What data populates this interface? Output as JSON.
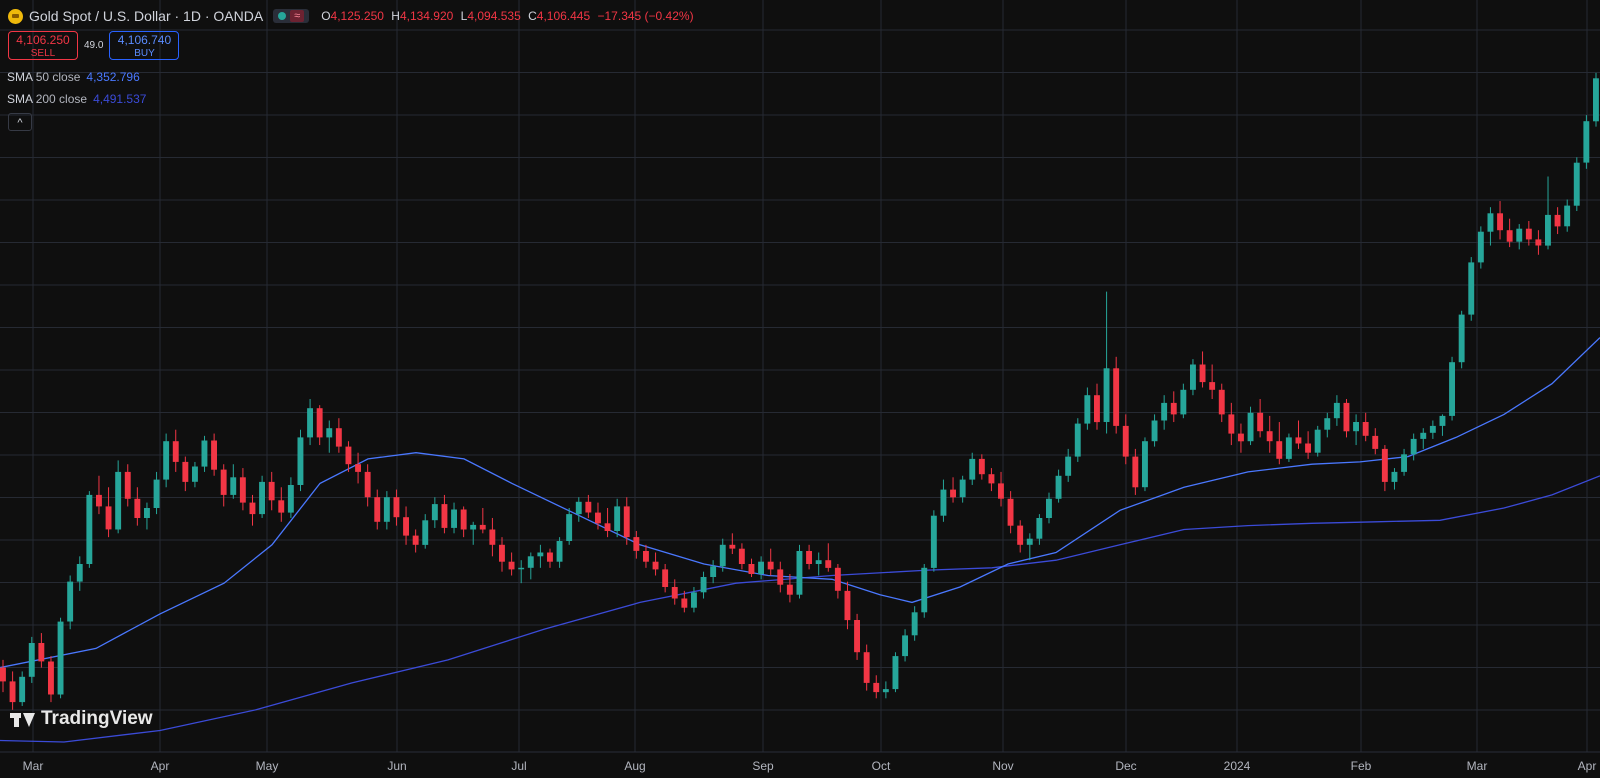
{
  "header": {
    "symbol_icon": "gold-coin-icon",
    "title": "Gold Spot / U.S. Dollar · 1D · OANDA",
    "ohlc": {
      "o": "4,125.250",
      "h": "4,134.920",
      "l": "4,094.535",
      "c": "4,106.445",
      "change": "−17.345 (−0.42%)"
    },
    "labels": {
      "o": "O",
      "h": "H",
      "l": "L",
      "c": "C"
    }
  },
  "trade": {
    "sell_price": "4,106.250",
    "sell_label": "SELL",
    "spread": "49.0",
    "buy_price": "4,106.740",
    "buy_label": "BUY"
  },
  "indicators": [
    {
      "name": "SMA",
      "params": "50 close",
      "value": "4,352.796",
      "color": "#4a78ff"
    },
    {
      "name": "SMA",
      "params": "200 close",
      "value": "4,491.537",
      "color": "#3b4bd8"
    }
  ],
  "collapse_glyph": "^",
  "branding": {
    "logo_text": "TradingView"
  },
  "colors": {
    "up": "#26a69a",
    "down": "#f23645",
    "background": "#0f0f0f",
    "grid": "#2a2e39"
  },
  "chart_data": {
    "type": "candlestick",
    "x_tick_labels": [
      "Mar",
      "Apr",
      "May",
      "Jun",
      "Jul",
      "Aug",
      "Sep",
      "Oct",
      "Nov",
      "Dec",
      "2024",
      "Feb",
      "Mar",
      "Apr"
    ],
    "y_range": [
      3880,
      4860
    ],
    "ohlc": [
      [
        3990,
        4000,
        3958,
        3972
      ],
      [
        3972,
        3985,
        3935,
        3945
      ],
      [
        3945,
        3985,
        3940,
        3978
      ],
      [
        3978,
        4030,
        3970,
        4022
      ],
      [
        4022,
        4035,
        3990,
        3998
      ],
      [
        3998,
        4005,
        3945,
        3955
      ],
      [
        3955,
        4055,
        3950,
        4050
      ],
      [
        4050,
        4110,
        4040,
        4102
      ],
      [
        4102,
        4135,
        4090,
        4125
      ],
      [
        4125,
        4220,
        4120,
        4215
      ],
      [
        4215,
        4240,
        4190,
        4200
      ],
      [
        4200,
        4225,
        4160,
        4170
      ],
      [
        4170,
        4260,
        4165,
        4245
      ],
      [
        4245,
        4255,
        4200,
        4210
      ],
      [
        4210,
        4225,
        4175,
        4185
      ],
      [
        4185,
        4205,
        4170,
        4198
      ],
      [
        4198,
        4245,
        4190,
        4235
      ],
      [
        4235,
        4295,
        4225,
        4285
      ],
      [
        4285,
        4300,
        4245,
        4258
      ],
      [
        4258,
        4265,
        4220,
        4232
      ],
      [
        4232,
        4258,
        4225,
        4252
      ],
      [
        4252,
        4292,
        4245,
        4286
      ],
      [
        4286,
        4295,
        4240,
        4248
      ],
      [
        4248,
        4255,
        4200,
        4215
      ],
      [
        4215,
        4255,
        4210,
        4238
      ],
      [
        4238,
        4250,
        4195,
        4205
      ],
      [
        4205,
        4215,
        4175,
        4190
      ],
      [
        4190,
        4240,
        4185,
        4232
      ],
      [
        4232,
        4245,
        4195,
        4208
      ],
      [
        4208,
        4225,
        4180,
        4192
      ],
      [
        4192,
        4238,
        4185,
        4228
      ],
      [
        4228,
        4300,
        4220,
        4290
      ],
      [
        4290,
        4340,
        4280,
        4328
      ],
      [
        4328,
        4332,
        4280,
        4290
      ],
      [
        4290,
        4312,
        4270,
        4302
      ],
      [
        4302,
        4315,
        4270,
        4278
      ],
      [
        4278,
        4285,
        4245,
        4255
      ],
      [
        4255,
        4270,
        4230,
        4245
      ],
      [
        4245,
        4255,
        4200,
        4212
      ],
      [
        4212,
        4222,
        4170,
        4180
      ],
      [
        4180,
        4220,
        4170,
        4212
      ],
      [
        4212,
        4222,
        4175,
        4186
      ],
      [
        4186,
        4200,
        4150,
        4162
      ],
      [
        4162,
        4170,
        4140,
        4150
      ],
      [
        4150,
        4190,
        4145,
        4182
      ],
      [
        4182,
        4212,
        4172,
        4203
      ],
      [
        4203,
        4215,
        4165,
        4172
      ],
      [
        4172,
        4205,
        4165,
        4196
      ],
      [
        4196,
        4200,
        4160,
        4170
      ],
      [
        4170,
        4180,
        4150,
        4176
      ],
      [
        4176,
        4198,
        4165,
        4170
      ],
      [
        4170,
        4185,
        4135,
        4150
      ],
      [
        4150,
        4160,
        4115,
        4128
      ],
      [
        4128,
        4140,
        4110,
        4118
      ],
      [
        4118,
        4130,
        4100,
        4120
      ],
      [
        4120,
        4140,
        4105,
        4135
      ],
      [
        4135,
        4150,
        4120,
        4140
      ],
      [
        4140,
        4145,
        4120,
        4128
      ],
      [
        4128,
        4160,
        4120,
        4155
      ],
      [
        4155,
        4198,
        4150,
        4190
      ],
      [
        4190,
        4212,
        4180,
        4206
      ],
      [
        4206,
        4215,
        4185,
        4192
      ],
      [
        4192,
        4205,
        4170,
        4178
      ],
      [
        4178,
        4198,
        4160,
        4168
      ],
      [
        4168,
        4210,
        4160,
        4200
      ],
      [
        4200,
        4212,
        4150,
        4160
      ],
      [
        4160,
        4168,
        4132,
        4142
      ],
      [
        4142,
        4150,
        4120,
        4128
      ],
      [
        4128,
        4140,
        4110,
        4118
      ],
      [
        4118,
        4125,
        4088,
        4095
      ],
      [
        4095,
        4105,
        4072,
        4080
      ],
      [
        4080,
        4090,
        4062,
        4068
      ],
      [
        4068,
        4095,
        4062,
        4088
      ],
      [
        4088,
        4115,
        4080,
        4108
      ],
      [
        4108,
        4130,
        4100,
        4122
      ],
      [
        4122,
        4158,
        4115,
        4150
      ],
      [
        4150,
        4165,
        4138,
        4145
      ],
      [
        4145,
        4152,
        4118,
        4125
      ],
      [
        4125,
        4132,
        4108,
        4112
      ],
      [
        4112,
        4135,
        4105,
        4128
      ],
      [
        4128,
        4145,
        4110,
        4118
      ],
      [
        4118,
        4128,
        4088,
        4098
      ],
      [
        4098,
        4112,
        4075,
        4085
      ],
      [
        4085,
        4150,
        4080,
        4142
      ],
      [
        4142,
        4150,
        4118,
        4125
      ],
      [
        4125,
        4140,
        4110,
        4130
      ],
      [
        4130,
        4152,
        4115,
        4120
      ],
      [
        4120,
        4125,
        4080,
        4090
      ],
      [
        4090,
        4102,
        4040,
        4052
      ],
      [
        4052,
        4060,
        4000,
        4010
      ],
      [
        4010,
        4020,
        3960,
        3970
      ],
      [
        3970,
        3980,
        3950,
        3958
      ],
      [
        3958,
        3972,
        3950,
        3962
      ],
      [
        3962,
        4010,
        3958,
        4005
      ],
      [
        4005,
        4040,
        3998,
        4032
      ],
      [
        4032,
        4070,
        4025,
        4062
      ],
      [
        4062,
        4125,
        4055,
        4120
      ],
      [
        4120,
        4195,
        4115,
        4188
      ],
      [
        4188,
        4235,
        4180,
        4222
      ],
      [
        4222,
        4238,
        4205,
        4212
      ],
      [
        4212,
        4240,
        4205,
        4235
      ],
      [
        4235,
        4270,
        4228,
        4262
      ],
      [
        4262,
        4268,
        4235,
        4242
      ],
      [
        4242,
        4250,
        4220,
        4230
      ],
      [
        4230,
        4245,
        4200,
        4210
      ],
      [
        4210,
        4220,
        4165,
        4175
      ],
      [
        4175,
        4182,
        4140,
        4150
      ],
      [
        4150,
        4165,
        4130,
        4158
      ],
      [
        4158,
        4190,
        4150,
        4185
      ],
      [
        4185,
        4218,
        4178,
        4210
      ],
      [
        4210,
        4248,
        4205,
        4240
      ],
      [
        4240,
        4275,
        4232,
        4265
      ],
      [
        4265,
        4315,
        4258,
        4308
      ],
      [
        4308,
        4355,
        4300,
        4345
      ],
      [
        4345,
        4360,
        4300,
        4310
      ],
      [
        4310,
        4480,
        4295,
        4380
      ],
      [
        4380,
        4395,
        4295,
        4305
      ],
      [
        4305,
        4320,
        4255,
        4265
      ],
      [
        4265,
        4275,
        4215,
        4225
      ],
      [
        4225,
        4290,
        4220,
        4285
      ],
      [
        4285,
        4320,
        4278,
        4312
      ],
      [
        4312,
        4345,
        4300,
        4335
      ],
      [
        4335,
        4350,
        4310,
        4320
      ],
      [
        4320,
        4360,
        4315,
        4352
      ],
      [
        4352,
        4392,
        4345,
        4385
      ],
      [
        4385,
        4402,
        4355,
        4362
      ],
      [
        4362,
        4385,
        4340,
        4352
      ],
      [
        4352,
        4360,
        4310,
        4320
      ],
      [
        4320,
        4335,
        4280,
        4295
      ],
      [
        4295,
        4308,
        4270,
        4285
      ],
      [
        4285,
        4330,
        4280,
        4322
      ],
      [
        4322,
        4340,
        4290,
        4298
      ],
      [
        4298,
        4318,
        4270,
        4285
      ],
      [
        4285,
        4310,
        4255,
        4262
      ],
      [
        4262,
        4295,
        4258,
        4290
      ],
      [
        4290,
        4312,
        4275,
        4282
      ],
      [
        4282,
        4298,
        4262,
        4270
      ],
      [
        4270,
        4305,
        4265,
        4300
      ],
      [
        4300,
        4322,
        4290,
        4315
      ],
      [
        4315,
        4345,
        4305,
        4335
      ],
      [
        4335,
        4340,
        4290,
        4298
      ],
      [
        4298,
        4320,
        4280,
        4310
      ],
      [
        4310,
        4322,
        4285,
        4292
      ],
      [
        4292,
        4302,
        4268,
        4275
      ],
      [
        4275,
        4280,
        4220,
        4232
      ],
      [
        4232,
        4250,
        4222,
        4245
      ],
      [
        4245,
        4275,
        4240,
        4268
      ],
      [
        4268,
        4295,
        4260,
        4288
      ],
      [
        4288,
        4302,
        4275,
        4296
      ],
      [
        4296,
        4312,
        4288,
        4305
      ],
      [
        4305,
        4320,
        4292,
        4318
      ],
      [
        4318,
        4395,
        4312,
        4388
      ],
      [
        4388,
        4455,
        4380,
        4450
      ],
      [
        4450,
        4525,
        4442,
        4518
      ],
      [
        4518,
        4565,
        4510,
        4558
      ],
      [
        4558,
        4590,
        4540,
        4582
      ],
      [
        4582,
        4598,
        4548,
        4560
      ],
      [
        4560,
        4575,
        4538,
        4545
      ],
      [
        4545,
        4568,
        4535,
        4562
      ],
      [
        4562,
        4572,
        4540,
        4548
      ],
      [
        4548,
        4560,
        4528,
        4540
      ],
      [
        4540,
        4630,
        4535,
        4580
      ],
      [
        4580,
        4590,
        4555,
        4565
      ],
      [
        4565,
        4600,
        4558,
        4592
      ],
      [
        4592,
        4655,
        4585,
        4648
      ],
      [
        4648,
        4710,
        4640,
        4702
      ],
      [
        4702,
        4765,
        4695,
        4758
      ]
    ],
    "sma50": [
      [
        0,
        3990
      ],
      [
        0.06,
        4015
      ],
      [
        0.1,
        4060
      ],
      [
        0.14,
        4100
      ],
      [
        0.17,
        4150
      ],
      [
        0.2,
        4230
      ],
      [
        0.23,
        4262
      ],
      [
        0.26,
        4270
      ],
      [
        0.29,
        4262
      ],
      [
        0.32,
        4230
      ],
      [
        0.36,
        4190
      ],
      [
        0.4,
        4150
      ],
      [
        0.44,
        4125
      ],
      [
        0.48,
        4110
      ],
      [
        0.52,
        4105
      ],
      [
        0.55,
        4085
      ],
      [
        0.57,
        4075
      ],
      [
        0.6,
        4095
      ],
      [
        0.63,
        4125
      ],
      [
        0.66,
        4140
      ],
      [
        0.7,
        4195
      ],
      [
        0.74,
        4225
      ],
      [
        0.78,
        4245
      ],
      [
        0.82,
        4255
      ],
      [
        0.85,
        4258
      ],
      [
        0.88,
        4265
      ],
      [
        0.91,
        4290
      ],
      [
        0.94,
        4320
      ],
      [
        0.97,
        4360
      ],
      [
        1.0,
        4420
      ]
    ],
    "sma200": [
      [
        0,
        3895
      ],
      [
        0.04,
        3893
      ],
      [
        0.1,
        3908
      ],
      [
        0.16,
        3935
      ],
      [
        0.22,
        3970
      ],
      [
        0.28,
        4000
      ],
      [
        0.34,
        4040
      ],
      [
        0.4,
        4075
      ],
      [
        0.46,
        4100
      ],
      [
        0.52,
        4110
      ],
      [
        0.58,
        4117
      ],
      [
        0.62,
        4120
      ],
      [
        0.66,
        4130
      ],
      [
        0.7,
        4150
      ],
      [
        0.74,
        4170
      ],
      [
        0.78,
        4175
      ],
      [
        0.82,
        4178
      ],
      [
        0.86,
        4180
      ],
      [
        0.9,
        4182
      ],
      [
        0.94,
        4198
      ],
      [
        0.97,
        4215
      ],
      [
        1.0,
        4240
      ]
    ]
  }
}
